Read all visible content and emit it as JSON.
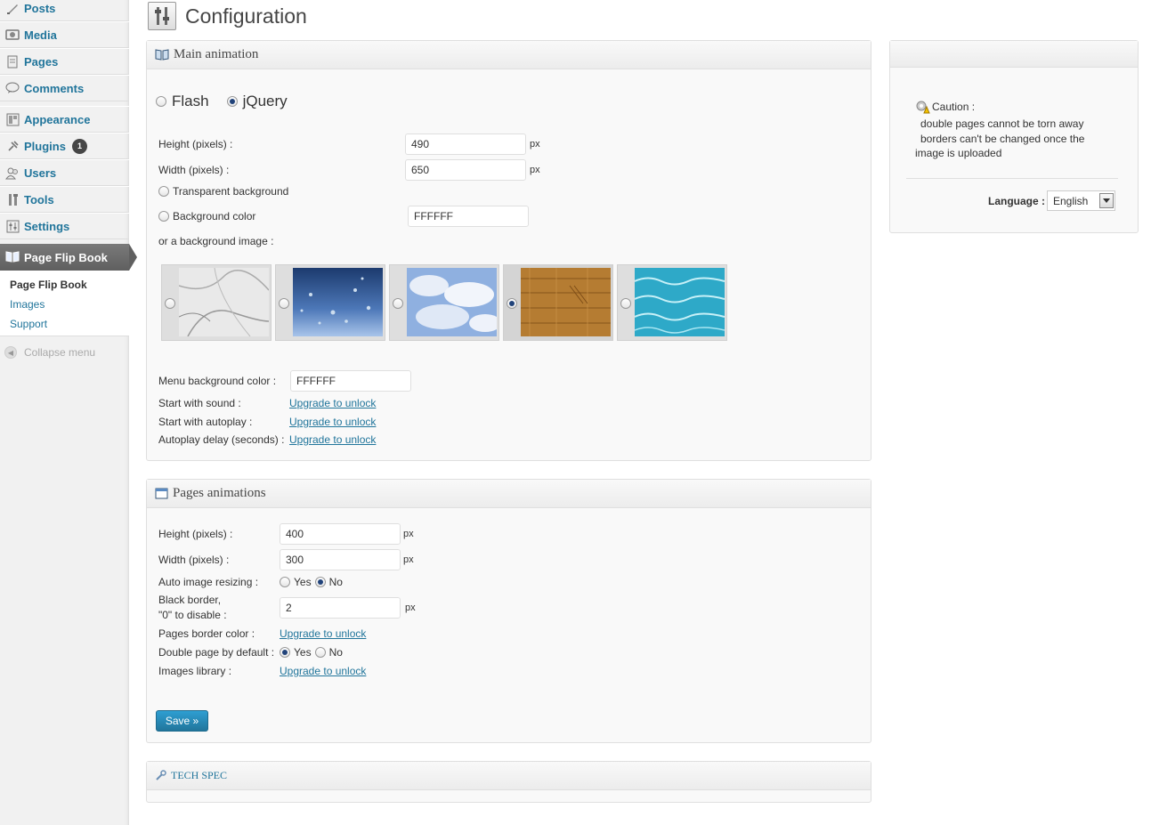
{
  "sidebar": {
    "items": [
      {
        "label": "Posts",
        "icon": "posts-icon"
      },
      {
        "label": "Media",
        "icon": "media-icon"
      },
      {
        "label": "Pages",
        "icon": "pages-icon"
      },
      {
        "label": "Comments",
        "icon": "comments-icon"
      },
      {
        "label": "Appearance",
        "icon": "appearance-icon"
      },
      {
        "label": "Plugins",
        "icon": "plugins-icon",
        "badge": "1"
      },
      {
        "label": "Users",
        "icon": "users-icon"
      },
      {
        "label": "Tools",
        "icon": "tools-icon"
      },
      {
        "label": "Settings",
        "icon": "settings-icon"
      }
    ],
    "active": {
      "label": "Page Flip Book",
      "icon": "book-icon"
    },
    "submenu": [
      "Page Flip Book",
      "Images",
      "Support"
    ],
    "collapse_label": "Collapse menu"
  },
  "header": {
    "title": "Configuration"
  },
  "main_animation": {
    "title": "Main animation",
    "engine_options": [
      "Flash",
      "jQuery"
    ],
    "engine_selected": "jQuery",
    "height_label": "Height (pixels) :",
    "height_value": "490",
    "width_label": "Width (pixels) :",
    "width_value": "650",
    "unit": "px",
    "transparent_label": "Transparent background",
    "bgcolor_label": "Background color",
    "bgcolor_value": "FFFFFF",
    "bgimage_label": "or a background image :",
    "bg_images": [
      "marble",
      "rain-drops",
      "clouds",
      "wood",
      "water"
    ],
    "bg_image_selected": "wood",
    "menu_bgcolor_label": "Menu background color :",
    "menu_bgcolor_value": "FFFFFF",
    "start_sound_label": "Start with sound :",
    "start_autoplay_label": "Start with autoplay :",
    "autoplay_delay_label": "Autoplay delay (seconds) :",
    "upgrade_label": "Upgrade to unlock"
  },
  "pages_animations": {
    "title": "Pages animations",
    "height_label": "Height (pixels) :",
    "height_value": "400",
    "width_label": "Width (pixels) :",
    "width_value": "300",
    "unit": "px",
    "auto_resize_label": "Auto image resizing :",
    "auto_resize_selected": "No",
    "yes_label": "Yes",
    "no_label": "No",
    "black_border_label_1": "Black border,",
    "black_border_label_2": "\"0\" to disable :",
    "black_border_value": "2",
    "border_color_label": "Pages border color :",
    "double_page_label": "Double page by default :",
    "double_page_selected": "Yes",
    "images_library_label": "Images library :",
    "upgrade_label": "Upgrade to unlock",
    "save_label": "Save »"
  },
  "tech_spec": {
    "title": "TECH SPEC"
  },
  "side": {
    "caution_title": "Caution :",
    "caution_line1": "double pages cannot be torn away",
    "caution_line2": "borders can't be changed once the",
    "caution_line3": "image is uploaded",
    "language_label": "Language :",
    "language_value": "English"
  },
  "colors": {
    "link": "#21759b",
    "active_menu": "#6b6b6b",
    "button": "#21759b"
  }
}
